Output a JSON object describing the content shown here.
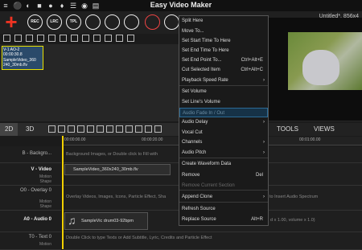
{
  "app": {
    "title": "Easy Video Maker",
    "project": "Untitled*, 856x4"
  },
  "toolbar": {
    "buttons": [
      "REC",
      "LRC",
      "TPL",
      "",
      "",
      "",
      ""
    ],
    "top_icons": [
      "≡",
      "⚫",
      "◐",
      "■",
      "●",
      "♦",
      "☰",
      "◉",
      "▤"
    ]
  },
  "media": {
    "thumb_lines": [
      "V-1 AO-2",
      "00:00:30.8",
      "SampleVideo_360",
      "240_30mb.flv"
    ]
  },
  "tabs": {
    "t2d": "2D",
    "t3d": "3D",
    "tools": "TOOLS",
    "views": "VIEWS"
  },
  "ruler": {
    "t0": "00:00:00.00",
    "t1": "00:00:20.00",
    "t2": "00:01:00.00"
  },
  "tracks": [
    {
      "name": "B - Backgro...",
      "sub": "",
      "hint": "Background Images, or Double click to Fill with"
    },
    {
      "name": "V - Video",
      "sub": "Motion\nShape",
      "hint": ""
    },
    {
      "name": "O0 - Overlay 0",
      "sub": "Motion\nShape",
      "hint": "Overlay Videos, Images, Icons, Particle Effect, Sha"
    },
    {
      "name": "A0 - Audio 0",
      "sub": "",
      "hint": ""
    },
    {
      "name": "T0 - Text 0",
      "sub": "Motion",
      "hint": "Double Click to type Texts or Add Subtitle, Lyric, Credits and Particle Effect"
    }
  ],
  "clips": {
    "video": "SampleVideo_360x240_30mb.flv",
    "audio": "SampleVic drum03-92bpm",
    "audio_right_hint": "d x 1.00, volume x 1.0)",
    "overlay_right_hint": "to Insert Audio Spectrum"
  },
  "menu": [
    {
      "label": "Split Here",
      "shortcut": "",
      "arrow": false,
      "state": "normal"
    },
    {
      "label": "Move To...",
      "shortcut": "",
      "arrow": false,
      "state": "normal"
    },
    {
      "label": "Set Start Time To Here",
      "shortcut": "",
      "arrow": false,
      "state": "normal"
    },
    {
      "label": "Set End Time To Here",
      "shortcut": "",
      "arrow": false,
      "state": "normal"
    },
    {
      "label": "Set End Point To...",
      "shortcut": "Ctrl+Alt+E",
      "arrow": false,
      "state": "normal"
    },
    {
      "label": "Cut Selected Item",
      "shortcut": "Ctrl+Alt+C",
      "arrow": false,
      "state": "normal"
    },
    {
      "label": "Playback Speed Rate",
      "shortcut": "",
      "arrow": true,
      "state": "normal"
    },
    {
      "label": "Set Volume",
      "shortcut": "",
      "arrow": false,
      "state": "normal"
    },
    {
      "label": "Set Line's Volume",
      "shortcut": "",
      "arrow": false,
      "state": "normal"
    },
    {
      "label": "Audio Fade In / Out",
      "shortcut": "",
      "arrow": false,
      "state": "highlight"
    },
    {
      "label": "Audio Delay",
      "shortcut": "",
      "arrow": true,
      "state": "normal"
    },
    {
      "label": "Vocal Cut",
      "shortcut": "",
      "arrow": false,
      "state": "normal"
    },
    {
      "label": "Channels",
      "shortcut": "",
      "arrow": true,
      "state": "normal"
    },
    {
      "label": "Audio Pitch",
      "shortcut": "",
      "arrow": true,
      "state": "normal"
    },
    {
      "label": "Create Waveform Data",
      "shortcut": "",
      "arrow": false,
      "state": "normal"
    },
    {
      "label": "Remove",
      "shortcut": "Del",
      "arrow": false,
      "state": "normal"
    },
    {
      "label": "Remove Current Section",
      "shortcut": "",
      "arrow": false,
      "state": "disabled"
    },
    {
      "label": "Append Clone",
      "shortcut": "",
      "arrow": true,
      "state": "normal"
    },
    {
      "label": "Refresh Source",
      "shortcut": "",
      "arrow": false,
      "state": "normal"
    },
    {
      "label": "Replace Source",
      "shortcut": "Alt+R",
      "arrow": false,
      "state": "normal"
    }
  ],
  "colors": {
    "accent": "#e8e000",
    "record": "#e44444",
    "menu_highlight": "#163247"
  }
}
